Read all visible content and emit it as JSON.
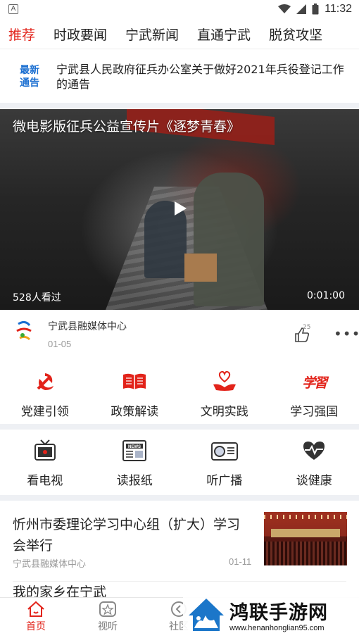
{
  "status_bar": {
    "left_icon_letter": "A",
    "time": "11:32"
  },
  "tabs": [
    {
      "label": "推荐",
      "active": true
    },
    {
      "label": "时政要闻"
    },
    {
      "label": "宁武新闻"
    },
    {
      "label": "直通宁武"
    },
    {
      "label": "脱贫攻坚"
    }
  ],
  "notice": {
    "badge_line1": "最新",
    "badge_line2": "通告",
    "text": "宁武县人民政府征兵办公室关于做好2021年兵役登记工作的通告"
  },
  "video": {
    "title": "微电影版征兵公益宣传片《逐梦青春》",
    "views": "528人看过",
    "duration": "0:01:00"
  },
  "source": {
    "name": "宁武县融媒体中心",
    "date": "01-05",
    "likes": "25"
  },
  "grid1": [
    {
      "label": "党建引领",
      "icon": "party-emblem-icon"
    },
    {
      "label": "政策解读",
      "icon": "open-book-icon"
    },
    {
      "label": "文明实践",
      "icon": "heart-hands-icon"
    },
    {
      "label": "学习强国",
      "icon": "xuexi-calligraphy-icon"
    }
  ],
  "grid1_xuexi_glyph": "学習",
  "grid2": [
    {
      "label": "看电视",
      "icon": "tv-icon"
    },
    {
      "label": "读报纸",
      "icon": "newspaper-icon"
    },
    {
      "label": "听广播",
      "icon": "radio-icon"
    },
    {
      "label": "谈健康",
      "icon": "heartbeat-icon"
    }
  ],
  "news_icon_text": "NEWS",
  "article": {
    "title": "忻州市委理论学习中心组（扩大）学习会举行",
    "source": "宁武县融媒体中心",
    "date": "01-11"
  },
  "article2_partial": "我的家乡在宁武",
  "bottom_nav": [
    {
      "label": "首页",
      "active": true
    },
    {
      "label": "视听"
    },
    {
      "label": "社区"
    }
  ],
  "watermark": {
    "title": "鸿联手游网",
    "url": "www.henanhonglian95.com"
  },
  "colors": {
    "accent": "#e2231a",
    "notice_blue": "#1b6fd1",
    "separator": "#eef0f4"
  }
}
